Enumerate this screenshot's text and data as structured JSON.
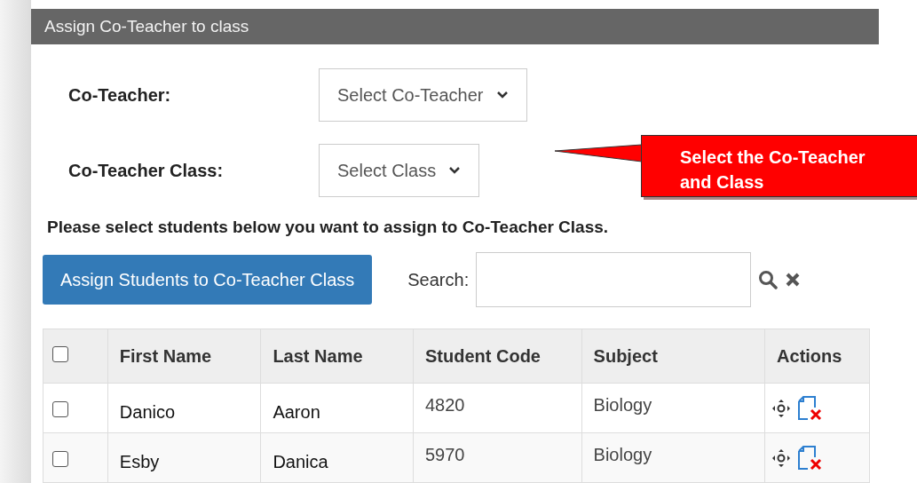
{
  "panel": {
    "title": "Assign Co-Teacher to class"
  },
  "fields": [
    {
      "label": "Co-Teacher:",
      "value": "Select Co-Teacher"
    },
    {
      "label": "Co-Teacher Class:",
      "value": "Select Class"
    }
  ],
  "callout": {
    "text": "Select the Co-Teacher and Class"
  },
  "instruction": "Please select students below you want to assign to Co-Teacher Class.",
  "assign_button": "Assign Students to Co-Teacher Class",
  "search": {
    "label": "Search:"
  },
  "table": {
    "columns": [
      "First Name",
      "Last Name",
      "Student Code",
      "Subject",
      "Actions"
    ],
    "header_checked": false,
    "rows": [
      {
        "checked": false,
        "first_name": "Danico",
        "last_name": "Aaron",
        "student_code": "4820",
        "subject": "Biology"
      },
      {
        "checked": false,
        "first_name": "Esby",
        "last_name": "Danica",
        "student_code": "5970",
        "subject": "Biology"
      }
    ]
  }
}
